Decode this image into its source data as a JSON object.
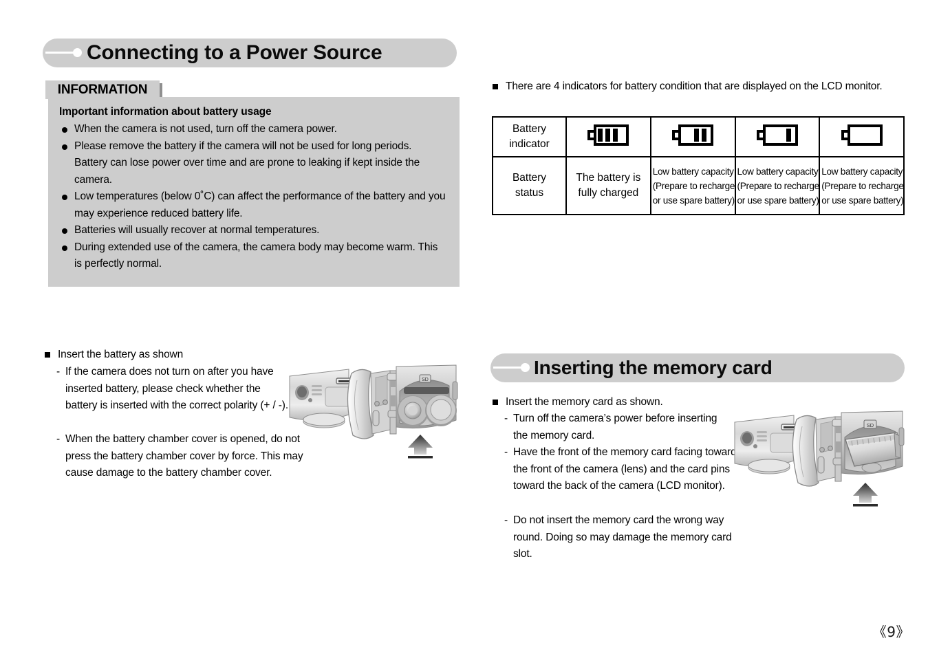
{
  "sections": {
    "power_source": {
      "title": "Connecting to a Power Source"
    },
    "memory_card": {
      "title": "Inserting the memory card"
    }
  },
  "information_panel": {
    "tab_label": "INFORMATION",
    "heading": "Important information about battery usage",
    "bullets": [
      "When the camera is not used, turn off the camera power.",
      "Please remove the battery if the camera will not be used for long periods. Battery can lose power over time and are prone to leaking if kept inside the camera.",
      "Low temperatures (below 0˚C) can affect the performance of the battery and you may experience reduced battery life.",
      "Batteries will usually recover at normal temperatures.",
      "During extended use of the camera, the camera body may become warm. This is perfectly normal."
    ]
  },
  "battery_indicators": {
    "intro": "There are 4 indicators for battery condition that are displayed on the LCD monitor.",
    "row_labels": {
      "indicator": "Battery indicator",
      "indicator_line1": "Battery",
      "indicator_line2": "indicator",
      "status": "Battery status",
      "status_line1": "Battery",
      "status_line2": "status"
    },
    "columns": [
      {
        "icon": "battery-full-icon",
        "bars": 3,
        "status_lines": [
          "The battery is",
          "fully charged"
        ],
        "small": false
      },
      {
        "icon": "battery-two-thirds-icon",
        "bars": 2,
        "status_lines": [
          "Low battery capacity",
          "(Prepare to recharge",
          "or use spare battery)"
        ],
        "small": true
      },
      {
        "icon": "battery-one-third-icon",
        "bars": 1,
        "status_lines": [
          "Low battery capacity",
          "(Prepare to recharge",
          "or use spare battery)"
        ],
        "small": true
      },
      {
        "icon": "battery-empty-icon",
        "bars": 0,
        "status_lines": [
          "Low battery capacity",
          "(Prepare to recharge",
          "or use spare battery)"
        ],
        "small": true
      }
    ]
  },
  "insert_battery": {
    "heading": "Insert the battery as shown",
    "notes": [
      "If the camera does not turn on after you have inserted battery, please check whether the battery is inserted with the correct polarity (+ / -).",
      "When the battery chamber cover is opened, do not press the battery chamber cover by force. This may cause damage to the battery chamber cover."
    ]
  },
  "insert_memory_card": {
    "heading": "Insert the memory card as shown.",
    "notes": [
      "Turn off the camera’s power before inserting the memory card.",
      "Have the front of the memory card facing toward the front of the camera (lens) and the card pins toward the back of the camera (LCD monitor).",
      "Do not insert the memory card the wrong way round. Doing so may damage the memory card slot."
    ]
  },
  "footer": {
    "page_number": "《9》"
  },
  "colors": {
    "panel_gray": "#cdcdcd",
    "tab_shadow": "#8f8f8f",
    "text": "#000000"
  }
}
